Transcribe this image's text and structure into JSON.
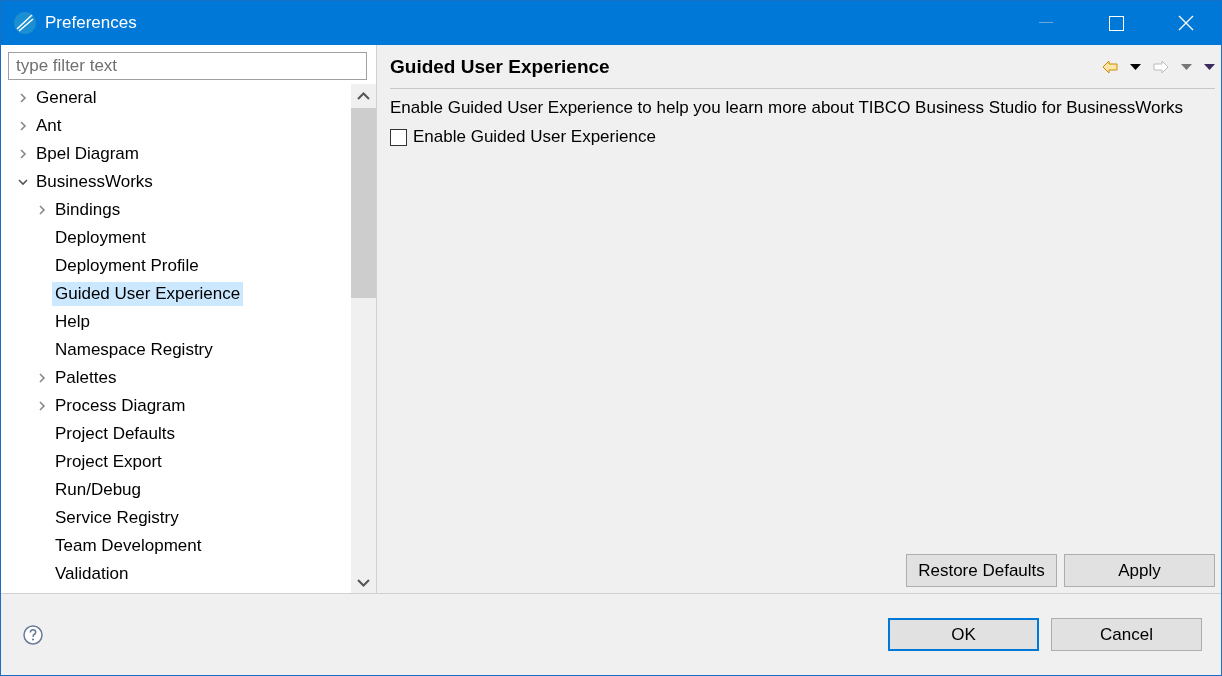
{
  "window": {
    "title": "Preferences"
  },
  "filter": {
    "placeholder": "type filter text"
  },
  "tree": [
    {
      "label": "General",
      "kind": "node",
      "expanded": false,
      "selected": false
    },
    {
      "label": "Ant",
      "kind": "node",
      "expanded": false,
      "selected": false
    },
    {
      "label": "Bpel Diagram",
      "kind": "node",
      "expanded": false,
      "selected": false
    },
    {
      "label": "BusinessWorks",
      "kind": "node",
      "expanded": true,
      "selected": false,
      "children": [
        {
          "label": "Bindings",
          "kind": "node",
          "expanded": false,
          "selected": false
        },
        {
          "label": "Deployment",
          "kind": "leaf",
          "selected": false
        },
        {
          "label": "Deployment Profile",
          "kind": "leaf",
          "selected": false
        },
        {
          "label": "Guided User Experience",
          "kind": "leaf",
          "selected": true
        },
        {
          "label": "Help",
          "kind": "leaf",
          "selected": false
        },
        {
          "label": "Namespace Registry",
          "kind": "leaf",
          "selected": false
        },
        {
          "label": "Palettes",
          "kind": "node",
          "expanded": false,
          "selected": false
        },
        {
          "label": "Process Diagram",
          "kind": "node",
          "expanded": false,
          "selected": false
        },
        {
          "label": "Project Defaults",
          "kind": "leaf",
          "selected": false
        },
        {
          "label": "Project Export",
          "kind": "leaf",
          "selected": false
        },
        {
          "label": "Run/Debug",
          "kind": "leaf",
          "selected": false
        },
        {
          "label": "Service Registry",
          "kind": "leaf",
          "selected": false
        },
        {
          "label": "Team Development",
          "kind": "leaf",
          "selected": false
        },
        {
          "label": "Validation",
          "kind": "leaf",
          "selected": false
        }
      ]
    }
  ],
  "page": {
    "title": "Guided User Experience",
    "description": "Enable Guided User Experience to help you learn more about TIBCO Business Studio for BusinessWorks",
    "checkbox": {
      "label": "Enable Guided User Experience",
      "checked": false
    },
    "buttons": [
      "Restore Defaults",
      "Apply"
    ]
  },
  "dialog_buttons": [
    {
      "label": "OK",
      "default": true
    },
    {
      "label": "Cancel",
      "default": false
    }
  ]
}
